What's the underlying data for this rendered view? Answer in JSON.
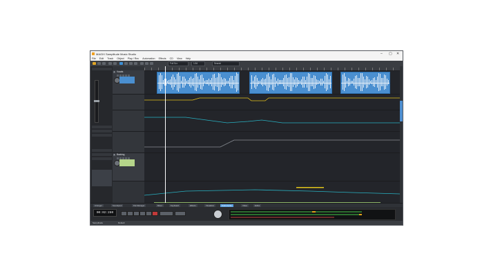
{
  "window": {
    "title": "MAGIX Samplitude Music Studio",
    "controls": [
      "–",
      "▢",
      "✕"
    ]
  },
  "menu": [
    "File",
    "Edit",
    "Track",
    "Object",
    "Play / Rec",
    "Automation",
    "Effects",
    "CD",
    "View",
    "Help"
  ],
  "toolbar": {
    "zoom_label": "Full Scr.",
    "grid_label": "1/16",
    "search_placeholder": "Search"
  },
  "tracks": [
    {
      "number": "1",
      "name": "Vocals"
    },
    {
      "number": "2",
      "name": "Backing"
    }
  ],
  "tabs": [
    "Arranger",
    "Soundpool",
    "File Manager",
    "Mixer",
    "Keyboard",
    "Effects",
    "Visualizer",
    "Instruments",
    "Video",
    "Editor"
  ],
  "active_tab": "Instruments",
  "transport": {
    "time": "00:02:280"
  },
  "status": {
    "left": "Samplitude",
    "right": "Default"
  },
  "colors": {
    "accent": "#e0a526",
    "audio_blue": "#4a8fd0",
    "audio_green": "#c7e39d",
    "meter_peak": "#e3a21a"
  }
}
